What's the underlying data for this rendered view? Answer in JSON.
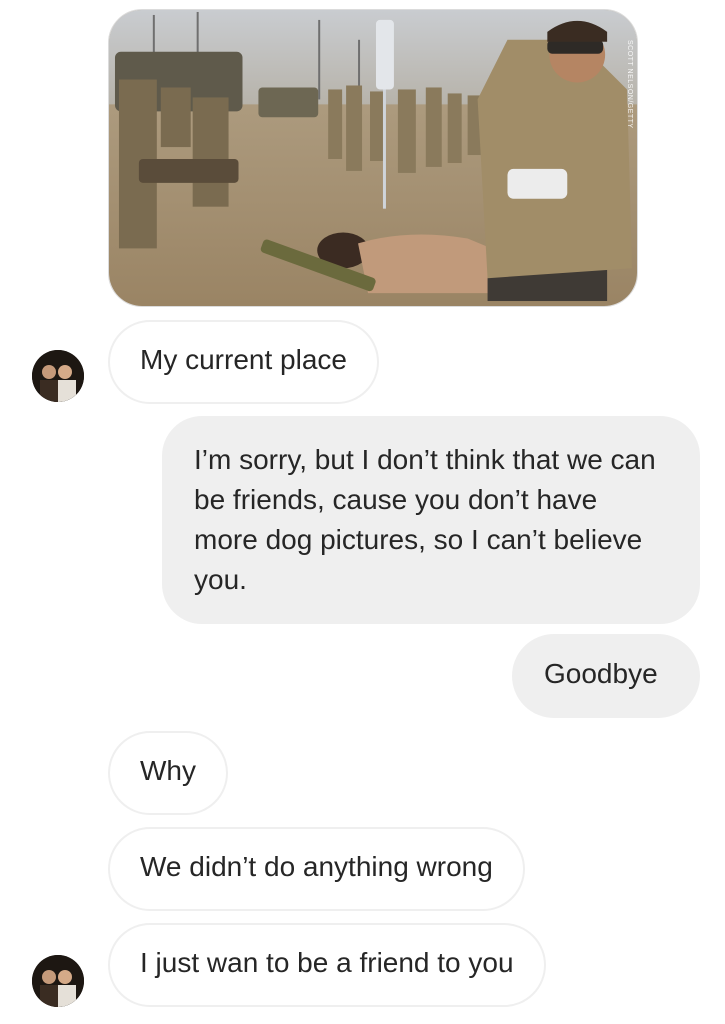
{
  "conversation": {
    "shared_photo": {
      "watermark": "SCOTT NELSON/GETTY",
      "description_icon": "photo-attachment"
    },
    "messages": [
      {
        "from": "them",
        "text": "My current place"
      },
      {
        "from": "me",
        "text": "I’m sorry, but I don’t think that we can be friends, cause you don’t have more dog pictures, so I can’t  believe you."
      },
      {
        "from": "me",
        "text": "Goodbye"
      },
      {
        "from": "them",
        "text": "Why"
      },
      {
        "from": "them",
        "text": "We didn’t do anything wrong"
      },
      {
        "from": "them",
        "text": "I just wan to be a friend to you"
      }
    ]
  },
  "colors": {
    "sent_bubble": "#efefef",
    "received_border": "#efefef",
    "text": "#262626",
    "background": "#ffffff"
  }
}
